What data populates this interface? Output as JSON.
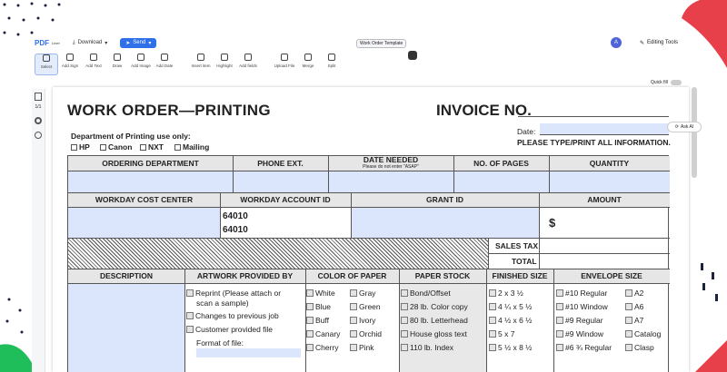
{
  "app": {
    "logo": "PDF",
    "logo_sub": "Liner",
    "download": "Download",
    "send": "Send",
    "doc_chip": "Work Order Template",
    "avatar": "A",
    "editing_tools": "Editing Tools"
  },
  "toolbar": [
    "Select",
    "Add Sign",
    "Add Text",
    "Draw",
    "Add Image",
    "Add Date",
    "Insert item",
    "Highlight",
    "Add fields",
    "Upload File",
    "Merge",
    "Split"
  ],
  "quick_fill": "Quick fill",
  "ask_ai": "Ask AI",
  "rail": {
    "pages": "1/1"
  },
  "form": {
    "title": "WORK ORDER—PRINTING",
    "invoice": "INVOICE NO.",
    "dept_label": "Department of Printing use only:",
    "dept_opts": [
      "HP",
      "Canon",
      "NXT",
      "Mailing"
    ],
    "date_label": "Date:",
    "please": "PLEASE TYPE/PRINT ALL INFORMATION.",
    "row1": [
      "ORDERING DEPARTMENT",
      "PHONE EXT.",
      "DATE NEEDED",
      "NO. OF PAGES",
      "QUANTITY"
    ],
    "date_note": "Please do not enter \"ASAP\"",
    "row2": [
      "WORKDAY COST CENTER",
      "WORKDAY ACCOUNT ID",
      "GRANT ID",
      "AMOUNT"
    ],
    "account_vals": [
      "64010",
      "64010"
    ],
    "dollar": "$",
    "sales_tax": "SALES TAX",
    "total": "TOTAL",
    "row3": [
      "DESCRIPTION",
      "ARTWORK PROVIDED BY",
      "COLOR OF PAPER",
      "PAPER STOCK",
      "FINISHED SIZE",
      "ENVELOPE SIZE"
    ],
    "artwork": [
      "Reprint (Please attach or",
      "scan a sample)",
      "Changes to previous job",
      "Customer provided file",
      "Format of file:"
    ],
    "colors_a": [
      "White",
      "Blue",
      "Buff",
      "Canary",
      "Cherry"
    ],
    "colors_b": [
      "Gray",
      "Green",
      "Ivory",
      "Orchid",
      "Pink"
    ],
    "stock": [
      "Bond/Offset",
      "28 lb. Color copy",
      "80 lb. Letterhead",
      "House gloss text",
      "110 lb. Index"
    ],
    "sizes": [
      "2 x 3 ½",
      "4 ¼ x 5 ½",
      "4 ½ x 6 ½",
      "5 x 7",
      "5 ½ x 8 ½"
    ],
    "env_a": [
      "#10 Regular",
      "#10 Window",
      "#9 Regular",
      "#9 Window",
      "#6 ¾ Regular"
    ],
    "env_b": [
      "A2",
      "A6",
      "A7",
      "Catalog",
      "Clasp"
    ]
  },
  "colors": {
    "accent": "#2f6fe8",
    "field": "#dbe5fb",
    "brand_red": "#e8404a",
    "brand_green": "#1fbe5a"
  }
}
